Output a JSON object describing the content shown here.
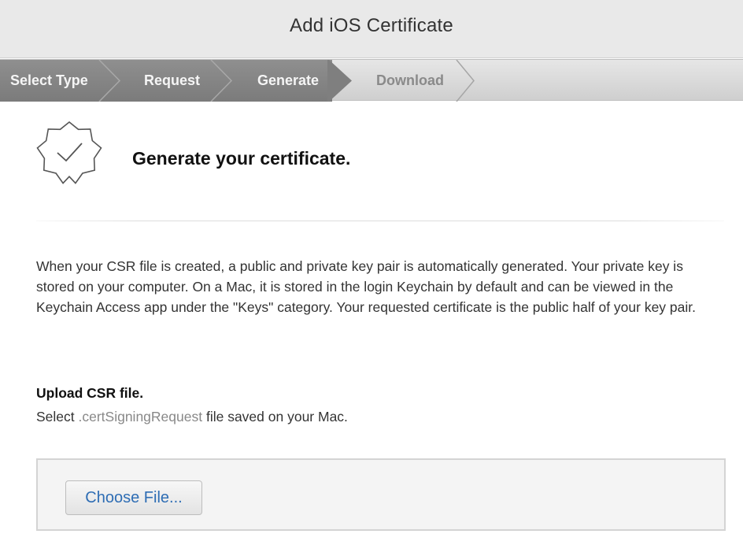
{
  "window": {
    "title": "Add iOS Certificate"
  },
  "steps": [
    {
      "label": "Select Type",
      "state": "done"
    },
    {
      "label": "Request",
      "state": "done"
    },
    {
      "label": "Generate",
      "state": "active"
    },
    {
      "label": "Download",
      "state": "pending"
    }
  ],
  "main": {
    "icon": "certificate-seal-checkmark-icon",
    "heading": "Generate your certificate.",
    "description": "When your CSR file is created, a public and private key pair is automatically generated. Your private key is stored on your computer. On a Mac, it is stored in the login Keychain by default and can be viewed in the Keychain Access app under the \"Keys\" category. Your requested certificate is the public half of your key pair.",
    "upload": {
      "heading": "Upload CSR file.",
      "hint_prefix": "Select ",
      "hint_extension": ".certSigningRequest",
      "hint_suffix": " file saved on your Mac.",
      "button_label": "Choose File..."
    }
  },
  "colors": {
    "button_text": "#2e6db4",
    "step_done_bg": "#858585",
    "step_pending_text": "#8a8a8a"
  }
}
